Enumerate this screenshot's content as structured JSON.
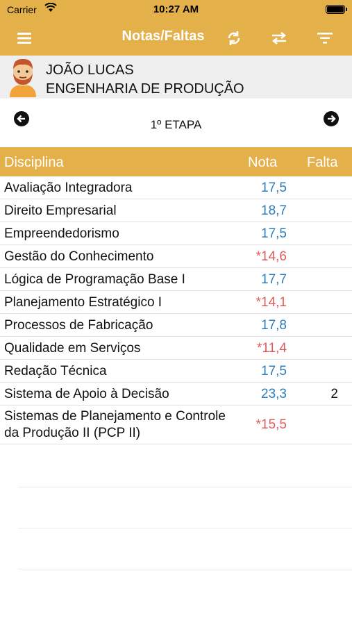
{
  "status_bar": {
    "carrier": "Carrier",
    "time": "10:27 AM"
  },
  "navbar": {
    "title": "Notas/Faltas",
    "icons": [
      "menu-icon",
      "refresh-icon",
      "swap-icon",
      "filter-icon"
    ]
  },
  "student": {
    "name": "JOÃO LUCAS",
    "course": "ENGENHARIA DE PRODUÇÃO"
  },
  "stage": {
    "label": "1º ETAPA"
  },
  "table": {
    "headers": {
      "discipline": "Disciplina",
      "grade": "Nota",
      "absences": "Falta"
    },
    "rows": [
      {
        "discipline": "Avaliação Integradora",
        "grade": "17,5",
        "absences": ""
      },
      {
        "discipline": "Direito Empresarial",
        "grade": "18,7",
        "absences": ""
      },
      {
        "discipline": "Empreendedorismo",
        "grade": "17,5",
        "absences": ""
      },
      {
        "discipline": "Gestão do Conhecimento",
        "grade": "*14,6",
        "absences": ""
      },
      {
        "discipline": "Lógica de Programação Base I",
        "grade": "17,7",
        "absences": ""
      },
      {
        "discipline": "Planejamento Estratégico I",
        "grade": "*14,1",
        "absences": ""
      },
      {
        "discipline": "Processos de Fabricação",
        "grade": "17,8",
        "absences": ""
      },
      {
        "discipline": "Qualidade em Serviços",
        "grade": "*11,4",
        "absences": ""
      },
      {
        "discipline": "Redação Técnica",
        "grade": "17,5",
        "absences": ""
      },
      {
        "discipline": "Sistema de Apoio à Decisão",
        "grade": "23,3",
        "absences": "2"
      },
      {
        "discipline": "Sistemas de Planejamento e Controle da Produção II (PCP II)",
        "grade": "*15,5",
        "absences": ""
      }
    ]
  },
  "colors": {
    "accent": "#e4b04a",
    "grade_ok": "#2a7db8",
    "grade_low": "#e05a5a",
    "profile_bg": "#efefef"
  }
}
